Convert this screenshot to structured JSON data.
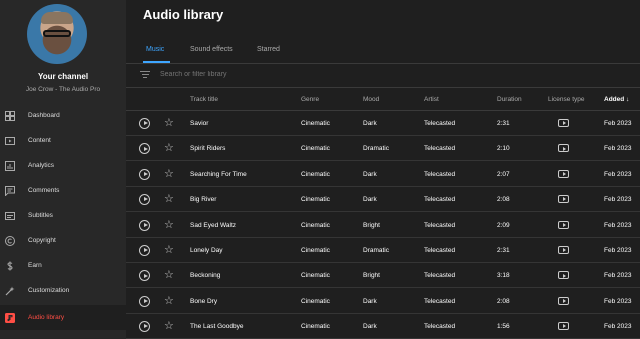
{
  "sidebar": {
    "channel_title": "Your channel",
    "channel_name": "Joe Crow - The Audio Pro",
    "items": [
      {
        "label": "Dashboard",
        "icon": "dashboard-icon"
      },
      {
        "label": "Content",
        "icon": "content-icon"
      },
      {
        "label": "Analytics",
        "icon": "analytics-icon"
      },
      {
        "label": "Comments",
        "icon": "comments-icon"
      },
      {
        "label": "Subtitles",
        "icon": "subtitles-icon"
      },
      {
        "label": "Copyright",
        "icon": "copyright-icon"
      },
      {
        "label": "Earn",
        "icon": "earn-icon"
      },
      {
        "label": "Customization",
        "icon": "customization-icon"
      },
      {
        "label": "Audio library",
        "icon": "audio-library-icon",
        "active": true
      }
    ]
  },
  "header": {
    "title": "Audio library"
  },
  "tabs": [
    {
      "label": "Music",
      "active": true
    },
    {
      "label": "Sound effects"
    },
    {
      "label": "Starred"
    }
  ],
  "search": {
    "placeholder": "Search or filter library"
  },
  "table": {
    "columns": [
      "Track title",
      "Genre",
      "Mood",
      "Artist",
      "Duration",
      "License type",
      "Added"
    ],
    "sort_indicator": "↓",
    "rows": [
      {
        "title": "Savior",
        "genre": "Cinematic",
        "mood": "Dark",
        "artist": "Telecasted",
        "duration": "2:31",
        "added": "Feb 2023"
      },
      {
        "title": "Spirit Riders",
        "genre": "Cinematic",
        "mood": "Dramatic",
        "artist": "Telecasted",
        "duration": "2:10",
        "added": "Feb 2023"
      },
      {
        "title": "Searching For Time",
        "genre": "Cinematic",
        "mood": "Dark",
        "artist": "Telecasted",
        "duration": "2:07",
        "added": "Feb 2023"
      },
      {
        "title": "Big River",
        "genre": "Cinematic",
        "mood": "Dark",
        "artist": "Telecasted",
        "duration": "2:08",
        "added": "Feb 2023"
      },
      {
        "title": "Sad Eyed Waltz",
        "genre": "Cinematic",
        "mood": "Bright",
        "artist": "Telecasted",
        "duration": "2:09",
        "added": "Feb 2023"
      },
      {
        "title": "Lonely Day",
        "genre": "Cinematic",
        "mood": "Dramatic",
        "artist": "Telecasted",
        "duration": "2:31",
        "added": "Feb 2023"
      },
      {
        "title": "Beckoning",
        "genre": "Cinematic",
        "mood": "Bright",
        "artist": "Telecasted",
        "duration": "3:18",
        "added": "Feb 2023"
      },
      {
        "title": "Bone Dry",
        "genre": "Cinematic",
        "mood": "Dark",
        "artist": "Telecasted",
        "duration": "2:08",
        "added": "Feb 2023"
      },
      {
        "title": "The Last Goodbye",
        "genre": "Cinematic",
        "mood": "Dark",
        "artist": "Telecasted",
        "duration": "1:56",
        "added": "Feb 2023"
      }
    ]
  },
  "colors": {
    "accent": "#3ea6ff",
    "active_nav": "#ff4e45",
    "background": "#1f1f1f",
    "sidebar": "#282828"
  }
}
